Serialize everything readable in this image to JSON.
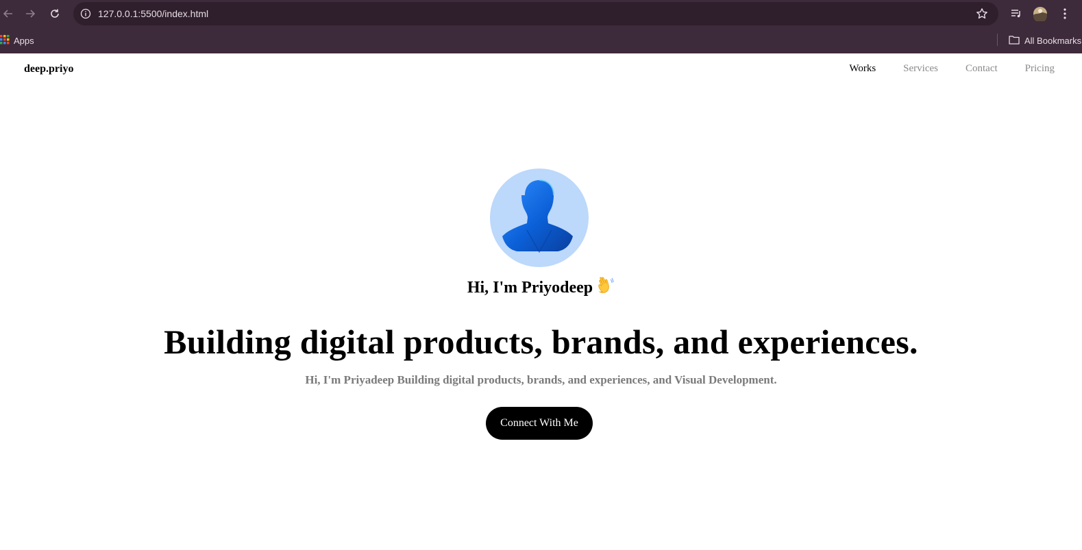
{
  "browser": {
    "url": "127.0.0.1:5500/index.html",
    "bookmarks": {
      "apps_label": "Apps",
      "all_bookmarks_label": "All Bookmarks"
    },
    "icons": [
      "back-icon",
      "forward-icon",
      "reload-icon",
      "site-info-icon",
      "star-icon",
      "media-icon",
      "profile-avatar",
      "menu-icon",
      "apps-grid-icon",
      "folder-icon"
    ],
    "colors": {
      "chrome": "#3d2a3a",
      "omnibox": "#2f1f2c"
    }
  },
  "header": {
    "logo": "deep.priyo",
    "nav": [
      {
        "label": "Works"
      },
      {
        "label": "Services"
      },
      {
        "label": "Contact"
      },
      {
        "label": "Pricing"
      }
    ]
  },
  "hero": {
    "greeting": "Hi, I'm Priyodeep",
    "wave_emoji": "👋",
    "headline": "Building digital products, brands, and experiences.",
    "subline": "Hi, I'm Priyadeep Building digital products, brands, and experiences, and Visual Development.",
    "cta_label": "Connect With Me"
  },
  "colors": {
    "avatar_bg": "#bcd8fb",
    "cta_bg": "#000000",
    "nav_inactive": "#8a8a8a",
    "subline": "#7a7a7a"
  }
}
